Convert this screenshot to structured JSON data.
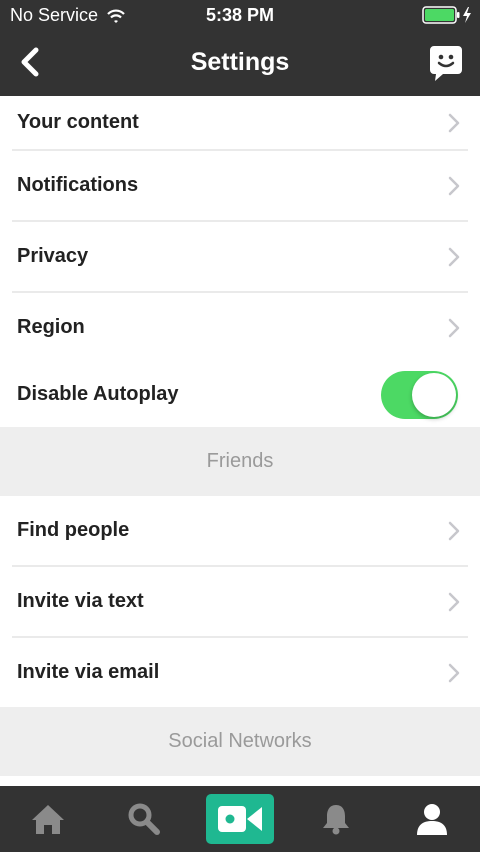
{
  "status_bar": {
    "carrier": "No Service",
    "time": "5:38 PM"
  },
  "nav": {
    "title": "Settings"
  },
  "settings_items": {
    "your_content": "Your content",
    "notifications": "Notifications",
    "privacy": "Privacy",
    "region": "Region",
    "disable_autoplay": "Disable Autoplay",
    "disable_autoplay_enabled": true
  },
  "friends_section": {
    "header": "Friends",
    "items": [
      "Find people",
      "Invite via text",
      "Invite via email"
    ]
  },
  "social_section": {
    "header": "Social Networks"
  },
  "tab_bar": {
    "tabs": [
      "home-icon",
      "search-icon",
      "record-video-icon",
      "bell-icon",
      "profile-icon"
    ]
  },
  "colors": {
    "bar": "#333333",
    "accent": "#1fb891",
    "toggle_on": "#4cd964",
    "battery": "#4cd964"
  }
}
